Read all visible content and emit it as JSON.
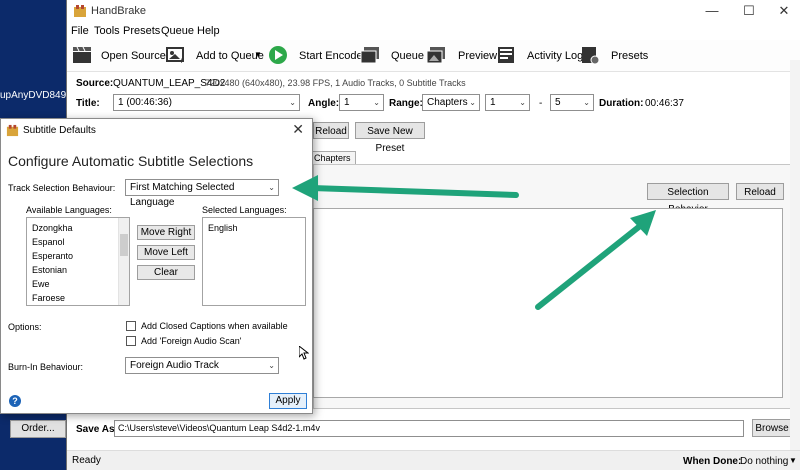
{
  "desktop": {
    "label": "upAnyDVD8490",
    "order_button": "Order..."
  },
  "window": {
    "title": "HandBrake",
    "controls": {
      "minimize": "—",
      "maximize": "☐",
      "close": "✕"
    }
  },
  "menu": [
    "File",
    "Tools",
    "Presets",
    "Queue",
    "Help"
  ],
  "toolbar": {
    "open_source": "Open Source",
    "add_to_queue": "Add to Queue",
    "start_encode": "Start Encode",
    "queue": "Queue",
    "preview": "Preview",
    "activity_log": "Activity Log",
    "presets": "Presets"
  },
  "source": {
    "label": "Source:",
    "name": "QUANTUM_LEAP_S4D2",
    "info": "720x480 (640x480), 23.98 FPS, 1 Audio Tracks, 0 Subtitle Tracks"
  },
  "title_row": {
    "title_label": "Title:",
    "title_value": "1 (00:46:36)",
    "angle_label": "Angle:",
    "angle_value": "1",
    "range_label": "Range:",
    "range_value": "Chapters",
    "range_from": "1",
    "range_sep": "-",
    "range_to": "5",
    "duration_label": "Duration:",
    "duration_value": "00:46:37"
  },
  "preset_buttons": {
    "reload": "Reload",
    "save_new": "Save New Preset"
  },
  "tabs": {
    "chapters": "Chapters"
  },
  "subtitles": {
    "selection_behavior": "Selection Behavior",
    "reload": "Reload"
  },
  "saveas": {
    "label": "Save As:",
    "path": "C:\\Users\\steve\\Videos\\Quantum Leap S4d2-1.m4v",
    "browse": "Browse"
  },
  "status": {
    "text": "Ready",
    "when_done_label": "When Done:",
    "when_done_value": "Do nothing"
  },
  "dialog": {
    "title": "Subtitle Defaults",
    "close": "✕",
    "heading": "Configure Automatic Subtitle Selections",
    "track_selection_label": "Track Selection Behaviour:",
    "track_selection_value": "First Matching Selected Language",
    "available_label": "Available Languages:",
    "available": [
      "Dzongkha",
      "Espanol",
      "Esperanto",
      "Estonian",
      "Ewe",
      "Faroese"
    ],
    "selected_label": "Selected Languages:",
    "selected": [
      "English"
    ],
    "move_right": "Move Right",
    "move_left": "Move Left",
    "clear": "Clear",
    "options_label": "Options:",
    "option_cc": "Add Closed Captions when available",
    "option_fas": "Add 'Foreign Audio Scan'",
    "burnin_label": "Burn-In Behaviour:",
    "burnin_value": "Foreign Audio Track",
    "help": "?",
    "apply": "Apply"
  },
  "colors": {
    "arrow": "#1fa37a",
    "desktop": "#0c2a6a",
    "accent": "#2f7fd6"
  }
}
